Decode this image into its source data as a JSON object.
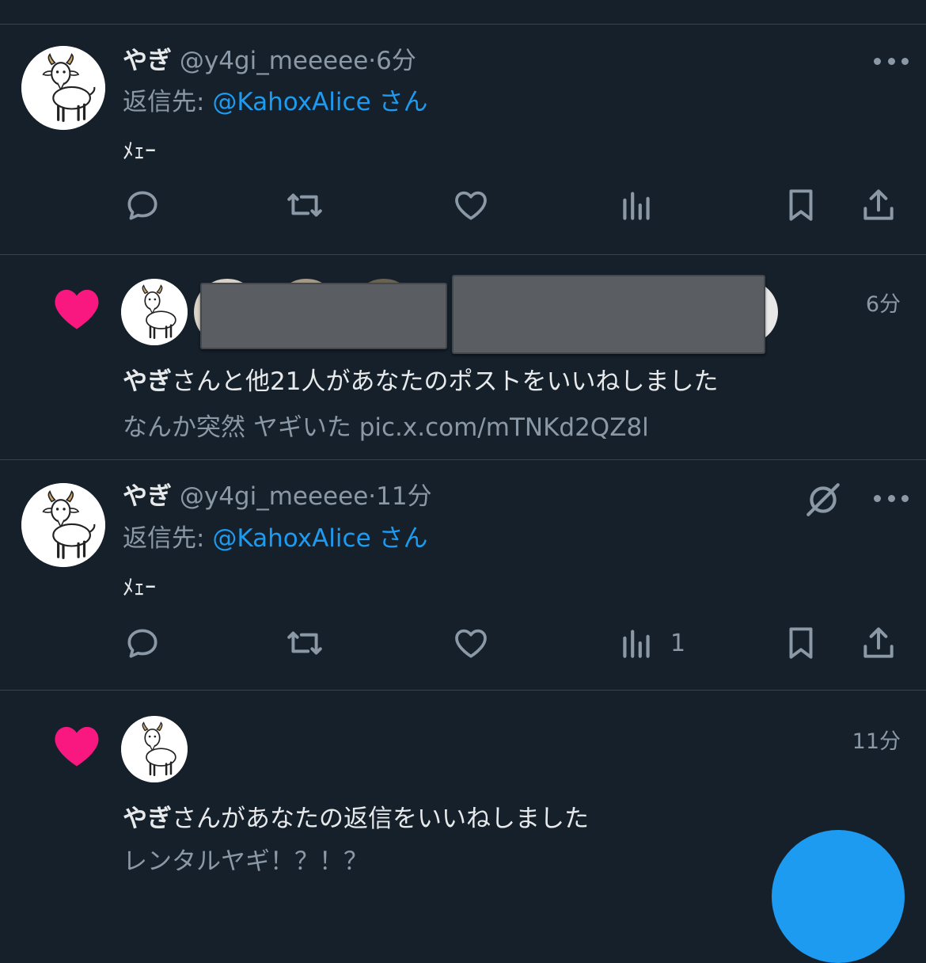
{
  "colors": {
    "background": "#15202b",
    "text": "#e7e9ea",
    "secondary": "#8b98a5",
    "accent": "#1d9bf0",
    "like_heart": "#f91880",
    "divider": "#38444d"
  },
  "tweets": [
    {
      "name": "やぎ",
      "handle": "@y4gi_meeeee",
      "dot": "·",
      "time": "6分",
      "reply_prefix": "返信先:",
      "reply_to": "@KahoxAlice",
      "reply_suffix": "さん",
      "body": "ﾒｪｰ",
      "view_count": "",
      "icons": [
        "reply-icon",
        "retweet-icon",
        "like-icon",
        "views-icon",
        "bookmark-icon",
        "share-icon",
        "more-icon"
      ]
    },
    {
      "name": "やぎ",
      "handle": "@y4gi_meeeee",
      "dot": "·",
      "time": "11分",
      "reply_prefix": "返信先:",
      "reply_to": "@KahoxAlice",
      "reply_suffix": "さん",
      "body": "ﾒｪｰ",
      "view_count": "1",
      "icons": [
        "reply-icon",
        "retweet-icon",
        "like-icon",
        "views-icon",
        "bookmark-icon",
        "share-icon",
        "grok-icon",
        "more-icon"
      ]
    }
  ],
  "notifications": [
    {
      "time": "6分",
      "actor": "やぎ",
      "text_rest": "さんと他21人があなたのポストをいいねしました",
      "preview": "なんか突然 ヤギいた pic.x.com/mTNKd2QZ8l"
    },
    {
      "time": "11分",
      "actor": "やぎ",
      "text_rest": "さんがあなたの返信をいいねしました",
      "preview": "レンタルヤギ！？！？"
    }
  ]
}
